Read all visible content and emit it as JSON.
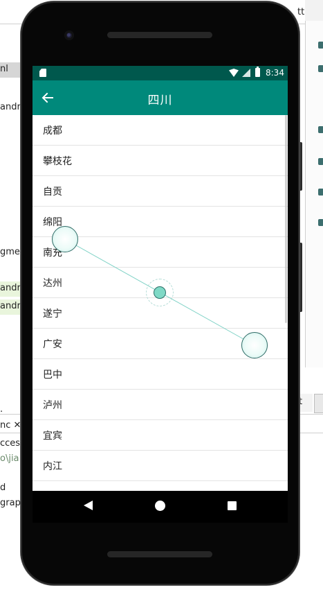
{
  "ide": {
    "lines": [
      "nl",
      "andr",
      "gmer",
      "andr",
      "andr",
      ".",
      "nc ✕",
      "ccess",
      "o\\jia",
      "d",
      "grap"
    ],
    "right_tab_label": "t",
    "top_right_text": "tt"
  },
  "status_bar": {
    "time": "8:34"
  },
  "app_bar": {
    "title": "四川",
    "back_icon": "arrow-back-icon"
  },
  "list": {
    "items": [
      {
        "label": "成都"
      },
      {
        "label": "攀枝花"
      },
      {
        "label": "自贡"
      },
      {
        "label": "绵阳"
      },
      {
        "label": "南充"
      },
      {
        "label": "达州"
      },
      {
        "label": "遂宁"
      },
      {
        "label": "广安"
      },
      {
        "label": "巴中"
      },
      {
        "label": "泸州"
      },
      {
        "label": "宜宾"
      },
      {
        "label": "内江"
      }
    ]
  },
  "colors": {
    "app_bar": "#00897b",
    "status_bar": "#00584d",
    "touch_line": "#7fd2c6"
  }
}
